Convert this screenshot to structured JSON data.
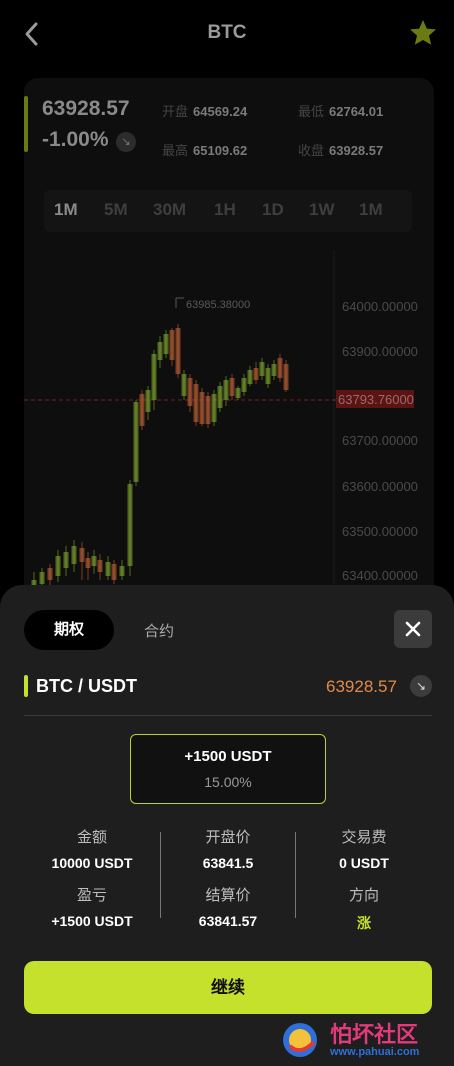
{
  "header": {
    "title": "BTC"
  },
  "ticker": {
    "price": "63928.57",
    "change": "-1.00%",
    "open_label": "开盘",
    "open_value": "64569.24",
    "low_label": "最低",
    "low_value": "62764.01",
    "high_label": "最高",
    "high_value": "65109.62",
    "close_label": "收盘",
    "close_value": "63928.57"
  },
  "timeframes": [
    "1M",
    "5M",
    "30M",
    "1H",
    "1D",
    "1W",
    "1M"
  ],
  "chart": {
    "y_labels": [
      "64000.00000",
      "63900.00000",
      "63700.00000",
      "63600.00000",
      "63500.00000",
      "63400.00000"
    ],
    "current_price_tag": "63793.76000",
    "high_marker": "63985.38000",
    "up_color": "#8ab532",
    "down_color": "#d2693a"
  },
  "sheet": {
    "tab_options": "期权",
    "tab_contract": "合约",
    "pair": "BTC / USDT",
    "pair_price": "63928.57",
    "profit_amount": "+1500 USDT",
    "profit_percent": "15.00%",
    "amount_label": "金额",
    "amount_value": "10000 USDT",
    "open_price_label": "开盘价",
    "open_price_value": "63841.5",
    "fee_label": "交易费",
    "fee_value": "0 USDT",
    "pnl_label": "盈亏",
    "pnl_value": "+1500 USDT",
    "settle_label": "结算价",
    "settle_value": "63841.57",
    "direction_label": "方向",
    "direction_value": "涨",
    "continue_label": "继续"
  },
  "watermark": {
    "text": "怕坏社区",
    "url": "www.pahuai.com"
  },
  "colors": {
    "accent": "#c5e12c",
    "price_orange": "#e08a4a",
    "sheet_bg": "#1e1e1e"
  }
}
